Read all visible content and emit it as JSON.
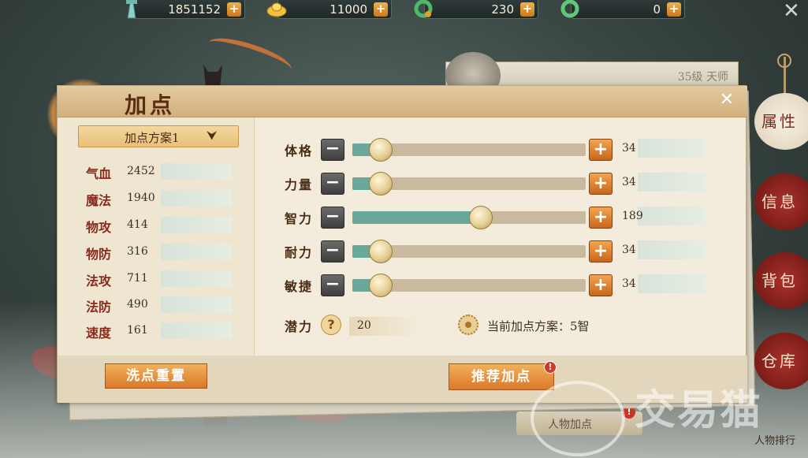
{
  "resources": [
    {
      "icon": "tower-icon",
      "value": "1851152"
    },
    {
      "icon": "gold-ingot-icon",
      "value": "11000"
    },
    {
      "icon": "jade-ring-icon",
      "value": "230"
    },
    {
      "icon": "green-jade-icon",
      "value": "0"
    }
  ],
  "plus_label": "+",
  "close_label": "✕",
  "character": {
    "level": "35级 天师"
  },
  "side_tabs": [
    {
      "label": "属性",
      "active": true
    },
    {
      "label": "信息",
      "active": false
    },
    {
      "label": "背包",
      "active": false
    },
    {
      "label": "仓库",
      "active": false
    }
  ],
  "bottom": {
    "character_button": "人物加点",
    "rank_label": "人物排行",
    "badge": "!"
  },
  "watermark": "交易猫",
  "dialog": {
    "title": "加点",
    "close": "✕",
    "plan_selector": {
      "label": "加点方案1",
      "arrow": "⮟"
    },
    "stats": [
      {
        "name": "气血",
        "value": "2452"
      },
      {
        "name": "魔法",
        "value": "1940"
      },
      {
        "name": "物攻",
        "value": "414"
      },
      {
        "name": "物防",
        "value": "316"
      },
      {
        "name": "法攻",
        "value": "711"
      },
      {
        "name": "法防",
        "value": "490"
      },
      {
        "name": "速度",
        "value": "161"
      }
    ],
    "attributes": [
      {
        "name": "体格",
        "value": "34",
        "level": 0.12
      },
      {
        "name": "力量",
        "value": "34",
        "level": 0.12
      },
      {
        "name": "智力",
        "value": "189",
        "level": 0.55
      },
      {
        "name": "耐力",
        "value": "34",
        "level": 0.12
      },
      {
        "name": "敏捷",
        "value": "34",
        "level": 0.12
      }
    ],
    "minus_label": "−",
    "plus_label": "+",
    "potential": {
      "label": "潜力",
      "help": "?",
      "value": "20"
    },
    "current_plan": "当前加点方案：5智",
    "reset_button": "洗点重置",
    "recommend_button": "推荐加点",
    "recommend_badge": "!"
  },
  "colors": {
    "accent_orange": "#d9792a",
    "slider_fill": "#6aa89c",
    "stat_red": "#8a2a1c"
  }
}
